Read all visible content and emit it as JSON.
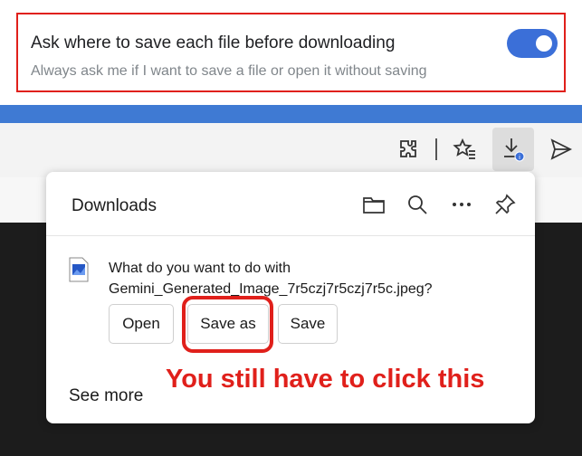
{
  "setting": {
    "title": "Ask where to save each file before downloading",
    "description": "Always ask me if I want to save a file or open it without saving",
    "toggle_on": true
  },
  "toolbar": {
    "icons": [
      "extensions-icon",
      "favorites-icon",
      "downloads-icon",
      "share-icon"
    ]
  },
  "downloads": {
    "title": "Downloads",
    "header_icons": [
      "folder-icon",
      "search-icon",
      "more-icon",
      "pin-icon"
    ],
    "question_line1": "What do you want to do with",
    "file_name": "Gemini_Generated_Image_7r5czj7r5czj7r5c.jpeg?",
    "buttons": {
      "open": "Open",
      "save_as": "Save as",
      "save": "Save"
    },
    "see_more": "See more"
  },
  "annotation": "You still have to click this",
  "colors": {
    "highlight": "#e0201b",
    "toggle": "#3b6fd8",
    "band": "#3f7ad3"
  }
}
